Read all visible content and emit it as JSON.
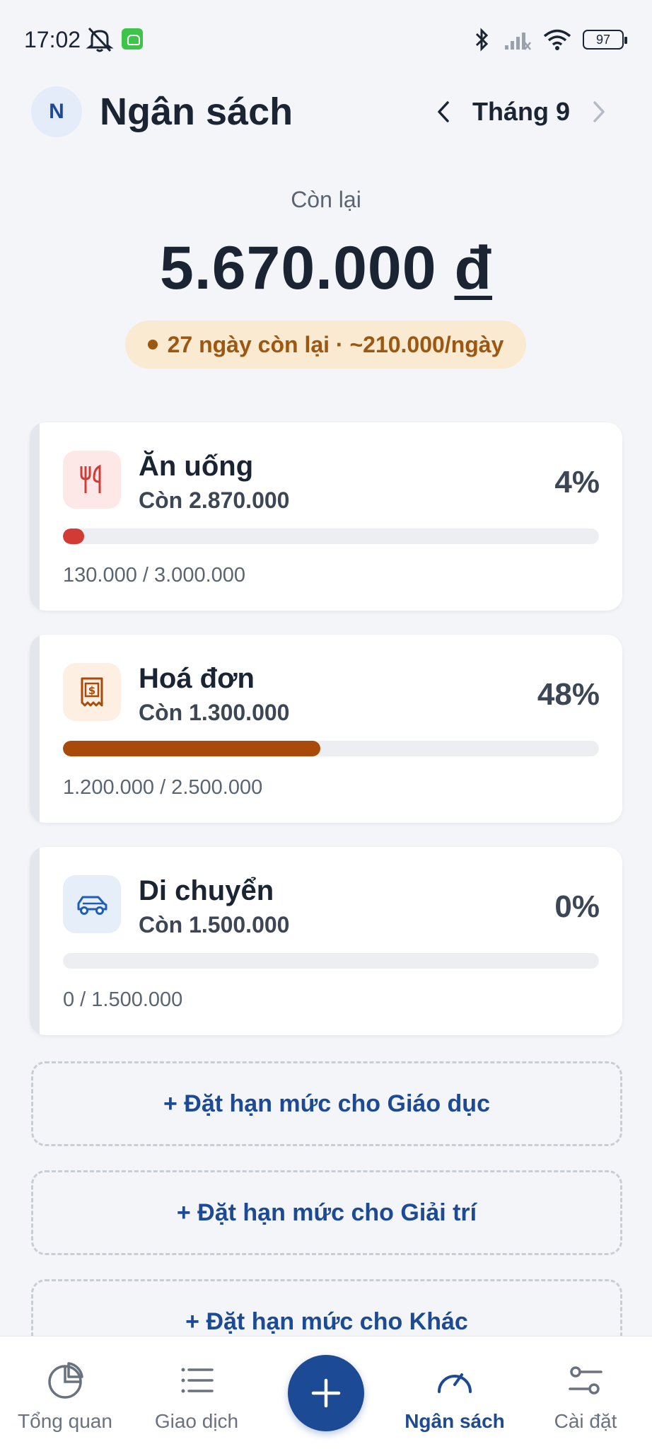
{
  "status_bar": {
    "time": "17:02",
    "battery": "97"
  },
  "header": {
    "avatar_initial": "N",
    "title": "Ngân sách",
    "month": "Tháng 9"
  },
  "summary": {
    "label": "Còn lại",
    "amount": "5.670.000",
    "currency": "đ",
    "days_info": "27 ngày còn lại · ~210.000/ngày"
  },
  "budgets": [
    {
      "name": "Ăn uống",
      "remaining": "Còn 2.870.000",
      "percent": "4%",
      "progress": 0.04,
      "spent": "130.000 / 3.000.000",
      "icon": "fork-knife-icon",
      "color": "#d23b35",
      "icon_bg": "#fde8e7"
    },
    {
      "name": "Hoá đơn",
      "remaining": "Còn 1.300.000",
      "percent": "48%",
      "progress": 0.48,
      "spent": "1.200.000 / 2.500.000",
      "icon": "receipt-icon",
      "color": "#a84a0a",
      "icon_bg": "#fdf0e2"
    },
    {
      "name": "Di chuyển",
      "remaining": "Còn 1.500.000",
      "percent": "0%",
      "progress": 0,
      "spent": "0 / 1.500.000",
      "icon": "car-icon",
      "color": "#1d5fb8",
      "icon_bg": "#e6eef9"
    }
  ],
  "add_limits": [
    "+ Đặt hạn mức cho Giáo dục",
    "+ Đặt hạn mức cho Giải trí",
    "+ Đặt hạn mức cho Khác"
  ],
  "bottom_nav": [
    {
      "label": "Tổng quan",
      "icon": "pie-chart-icon"
    },
    {
      "label": "Giao dịch",
      "icon": "list-icon"
    },
    {
      "label": "Ngân sách",
      "icon": "gauge-icon",
      "active": true
    },
    {
      "label": "Cài đặt",
      "icon": "settings-sliders-icon"
    }
  ],
  "colors": {
    "accent": "#1d4a94",
    "background": "#f3f5f8"
  }
}
